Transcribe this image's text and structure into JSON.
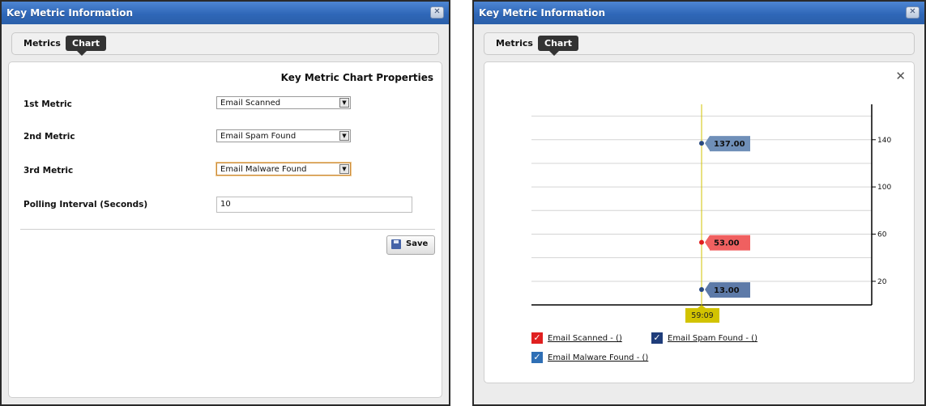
{
  "left_window": {
    "title": "Key Metric Information",
    "close_glyph": "✕",
    "tabs": {
      "metrics": "Metrics",
      "chart": "Chart"
    },
    "properties_title": "Key Metric Chart Properties",
    "fields": [
      {
        "label": "1st Metric",
        "value": "Email Scanned"
      },
      {
        "label": "2nd Metric",
        "value": "Email Spam Found"
      },
      {
        "label": "3rd Metric",
        "value": "Email Malware Found"
      }
    ],
    "polling": {
      "label": "Polling Interval (Seconds)",
      "value": "10"
    },
    "save_label": "Save"
  },
  "right_window": {
    "title": "Key Metric Information",
    "close_glyph": "✕",
    "tabs": {
      "metrics": "Metrics",
      "chart": "Chart"
    },
    "tool_icon": "wrench-screwdriver-icon",
    "legend": [
      {
        "label": "Email Scanned - ()",
        "color": "#e02020"
      },
      {
        "label": "Email Spam Found - ()",
        "color": "#1f3d7a"
      },
      {
        "label": "Email Malware Found - ()",
        "color": "#2f6fb5"
      }
    ]
  },
  "chart_data": {
    "type": "line",
    "x": [
      "59:09"
    ],
    "y_ticks": [
      20,
      60,
      100,
      140
    ],
    "ylim": [
      0,
      170
    ],
    "grid": true,
    "y_axis_side": "right",
    "series": [
      {
        "name": "Email Scanned - ()",
        "values": [
          137
        ],
        "label": "137.00",
        "color": "#6f8fb8"
      },
      {
        "name": "Email Spam Found - ()",
        "values": [
          53
        ],
        "label": "53.00",
        "color": "#f06060"
      },
      {
        "name": "Email Malware Found - ()",
        "values": [
          13
        ],
        "label": "13.00",
        "color": "#5d7aa8"
      }
    ],
    "cursor_label": "59:09",
    "cursor_color": "#d2c300"
  }
}
